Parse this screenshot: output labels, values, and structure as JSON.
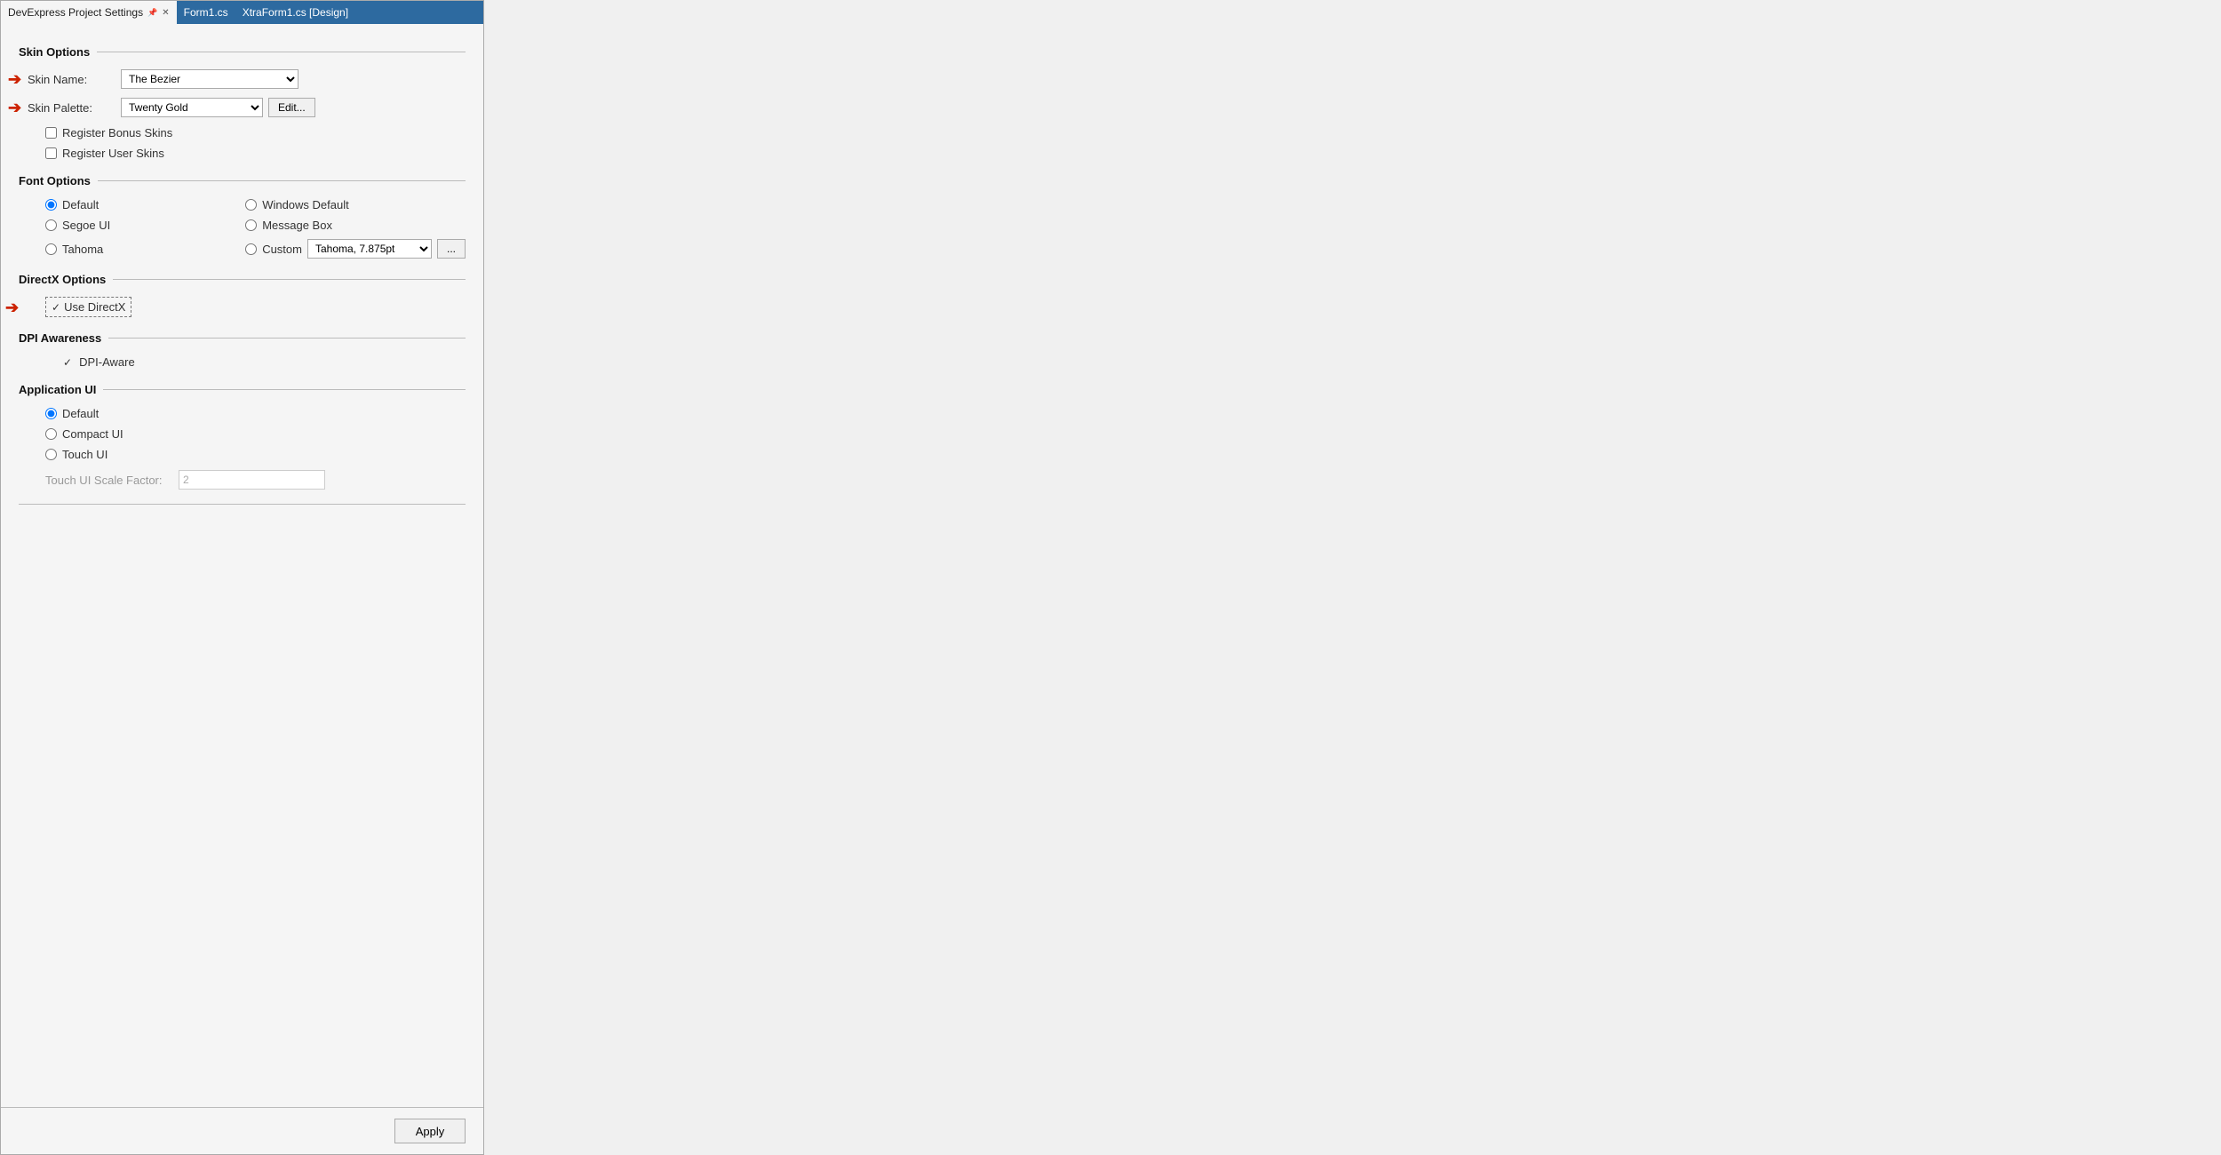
{
  "tabs": [
    {
      "id": "project-settings",
      "label": "DevExpress Project Settings",
      "active": true,
      "pinned": true,
      "closable": true
    },
    {
      "id": "form1",
      "label": "Form1.cs",
      "active": false,
      "pinned": false,
      "closable": false
    },
    {
      "id": "xtraform",
      "label": "XtraForm1.cs [Design]",
      "active": false,
      "pinned": false,
      "closable": false
    }
  ],
  "sections": {
    "skin_options": {
      "title": "Skin Options",
      "skin_name_label": "Skin Name:",
      "skin_name_value": "The Bezier",
      "skin_palette_label": "Skin Palette:",
      "skin_palette_value": "Twenty Gold",
      "edit_button": "Edit...",
      "register_bonus": "Register Bonus Skins",
      "register_user": "Register User Skins"
    },
    "font_options": {
      "title": "Font Options",
      "options": [
        {
          "id": "default",
          "label": "Default",
          "checked": true
        },
        {
          "id": "windows_default",
          "label": "Windows Default",
          "checked": false
        },
        {
          "id": "segoe_ui",
          "label": "Segoe UI",
          "checked": false
        },
        {
          "id": "message_box",
          "label": "Message Box",
          "checked": false
        },
        {
          "id": "tahoma",
          "label": "Tahoma",
          "checked": false
        }
      ],
      "custom_label": "Custom",
      "custom_value": "Tahoma, 7.875pt",
      "ellipsis_btn": "..."
    },
    "directx_options": {
      "title": "DirectX Options",
      "use_directx": "Use DirectX",
      "use_directx_checked": true
    },
    "dpi_awareness": {
      "title": "DPI Awareness",
      "dpi_aware": "DPI-Aware",
      "dpi_aware_checked": true
    },
    "application_ui": {
      "title": "Application UI",
      "options": [
        {
          "id": "default",
          "label": "Default",
          "checked": true
        },
        {
          "id": "compact_ui",
          "label": "Compact UI",
          "checked": false
        },
        {
          "id": "touch_ui",
          "label": "Touch UI",
          "checked": false
        }
      ],
      "scale_label": "Touch UI Scale Factor:",
      "scale_value": "2"
    }
  },
  "apply_button": "Apply"
}
